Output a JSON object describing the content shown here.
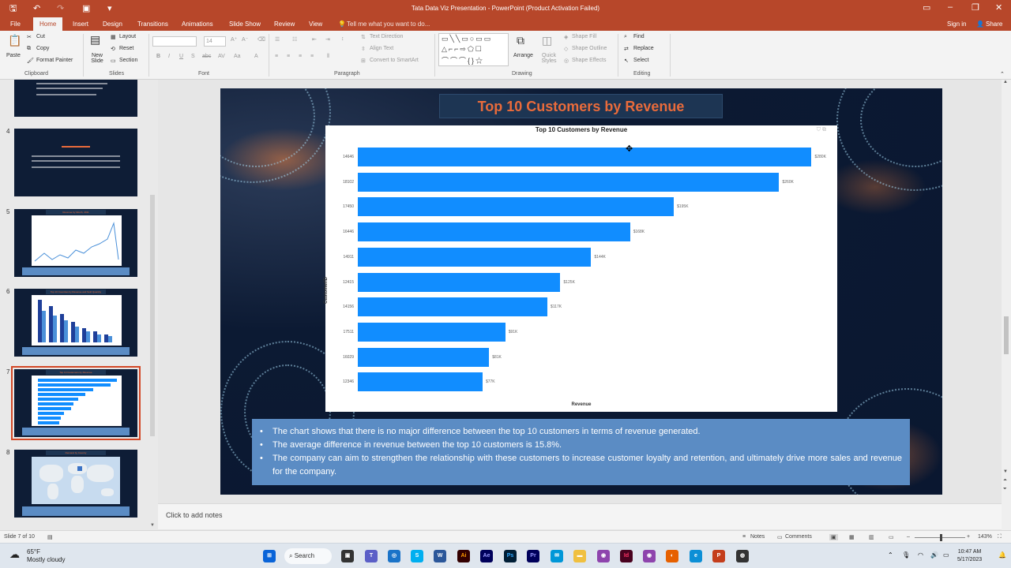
{
  "window": {
    "title": "Tata Data Viz Presentation - PowerPoint (Product Activation Failed)",
    "sign_in": "Sign in",
    "share": "Share"
  },
  "tabs": [
    "File",
    "Home",
    "Insert",
    "Design",
    "Transitions",
    "Animations",
    "Slide Show",
    "Review",
    "View"
  ],
  "tell_me": "Tell me what you want to do...",
  "ribbon": {
    "clipboard": {
      "paste": "Paste",
      "cut": "Cut",
      "copy": "Copy",
      "format_painter": "Format Painter",
      "group": "Clipboard"
    },
    "slides": {
      "new_slide": "New Slide",
      "layout": "Layout",
      "reset": "Reset",
      "section": "Section",
      "group": "Slides"
    },
    "font": {
      "size": "14",
      "group": "Font"
    },
    "paragraph": {
      "text_direction": "Text Direction",
      "align_text": "Align Text",
      "convert": "Convert to SmartArt",
      "group": "Paragraph"
    },
    "drawing": {
      "arrange": "Arrange",
      "quick_styles": "Quick Styles",
      "shape_fill": "Shape Fill",
      "shape_outline": "Shape Outline",
      "shape_effects": "Shape Effects",
      "group": "Drawing"
    },
    "editing": {
      "find": "Find",
      "replace": "Replace",
      "select": "Select",
      "group": "Editing"
    }
  },
  "thumbnails": [
    {
      "num": "4"
    },
    {
      "num": "5",
      "title": "Revenue by Month, 2011"
    },
    {
      "num": "6",
      "title": "Top 10 Countries by Revenue and Sold Quantity"
    },
    {
      "num": "7",
      "title": "Top 10 Customers by Revenue"
    },
    {
      "num": "8",
      "title": "Demand by Country"
    }
  ],
  "slide": {
    "title": "Top 10 Customers by Revenue",
    "bullets": [
      "The chart shows that there is no major difference between the top 10 customers in terms of revenue generated.",
      "The average difference in revenue between the top 10 customers is 15.8%.",
      "The company can aim to strengthen the relationship with these customers to increase customer loyalty and retention, and ultimately drive more sales and revenue for the company."
    ]
  },
  "chart_data": {
    "type": "bar",
    "orientation": "horizontal",
    "title": "Top 10 Customers by Revenue",
    "xlabel": "Revenue",
    "ylabel": "CustomerID",
    "categories": [
      "14646",
      "18102",
      "17450",
      "16446",
      "14911",
      "12415",
      "14156",
      "17511",
      "16029",
      "12346"
    ],
    "values": [
      280,
      260,
      195,
      168,
      144,
      125,
      117,
      91,
      81,
      77
    ],
    "value_labels": [
      "$280K",
      "$260K",
      "$195K",
      "$168K",
      "$144K",
      "$125K",
      "$117K",
      "$91K",
      "$81K",
      "$77K"
    ],
    "color": "#118DFF",
    "xlim": [
      0,
      290
    ],
    "grid": false
  },
  "notes": {
    "placeholder": "Click to add notes"
  },
  "status": {
    "slide_info": "Slide 7 of 10",
    "notes": "Notes",
    "comments": "Comments",
    "zoom": "143%"
  },
  "taskbar": {
    "temp": "65°F",
    "weather": "Mostly cloudy",
    "search": "Search",
    "time": "10:47 AM",
    "date": "5/17/2023"
  }
}
